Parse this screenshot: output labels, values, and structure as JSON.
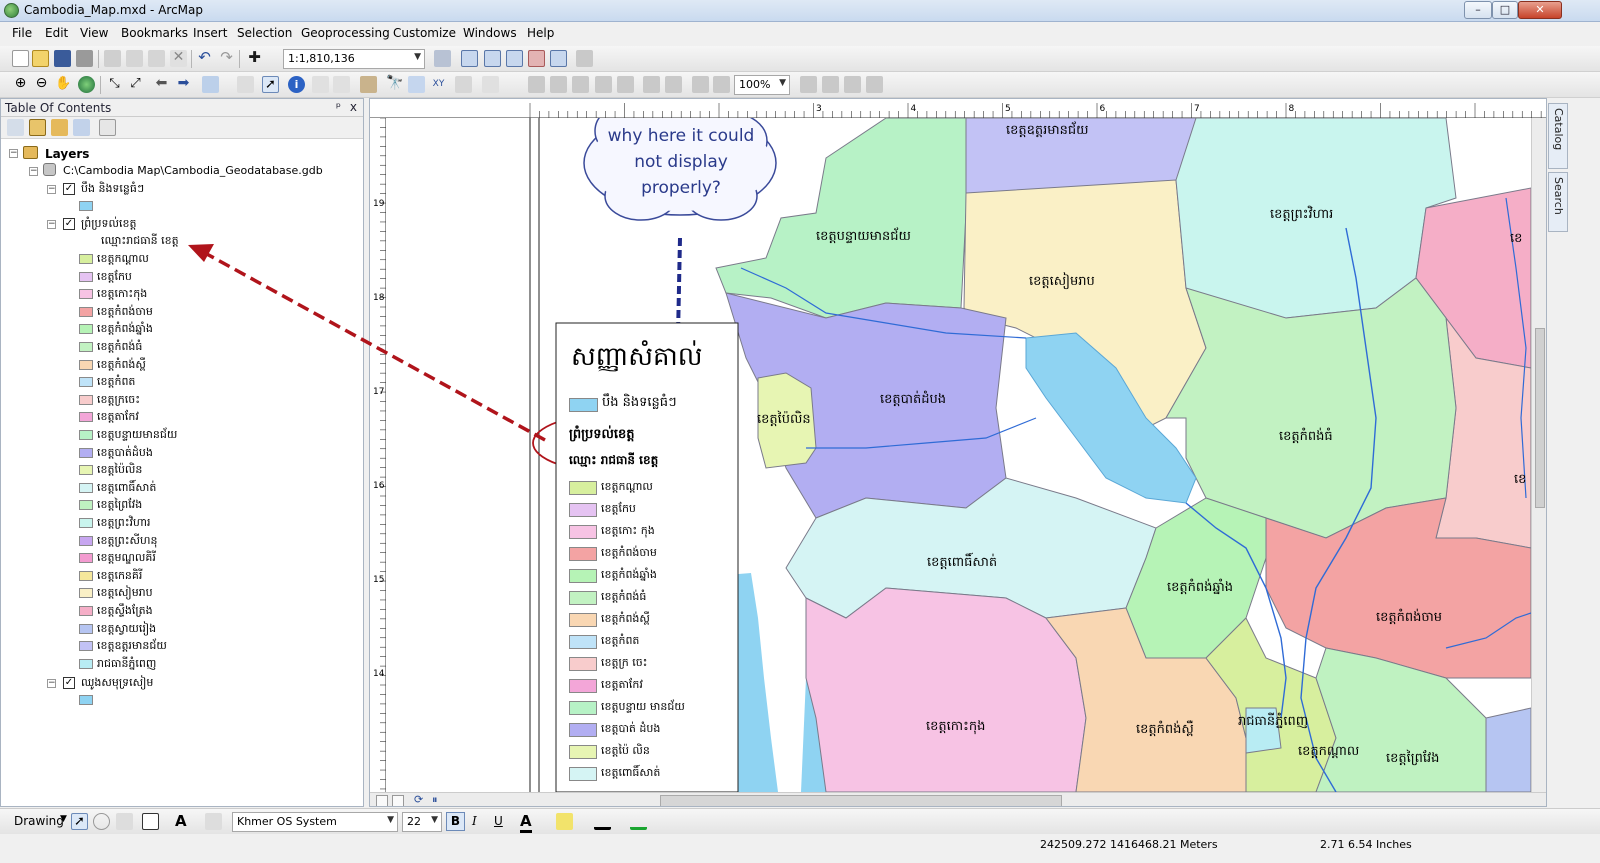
{
  "window": {
    "title": "Cambodia_Map.mxd - ArcMap",
    "min": "–",
    "max": "□",
    "close": "✕"
  },
  "menu": [
    "File",
    "Edit",
    "View",
    "Bookmarks",
    "Insert",
    "Selection",
    "Geoprocessing",
    "Customize",
    "Windows",
    "Help"
  ],
  "toolbar": {
    "scale": "1:1,810,136",
    "zoom": "100%"
  },
  "toc": {
    "header": "Table Of Contents",
    "pin": "ᵖ",
    "close": "x",
    "layers_label": "Layers",
    "gdb_path": "C:\\Cambodia Map\\Cambodia_Geodatabase.gdb",
    "lake_layer": "បឹង និងទន្លេធំៗ",
    "province_layer": "ព្រំប្រទល់ខេត្ត",
    "field_name": "ឈ្មោះរាជធានី ខេត្ត",
    "provinces": [
      {
        "name": "ខេត្តកណ្តាល",
        "color": "#d7ef9e"
      },
      {
        "name": "ខេត្តកែប",
        "color": "#e5c3f2"
      },
      {
        "name": "ខេត្តកោះកុង",
        "color": "#f7c3e4"
      },
      {
        "name": "ខេត្តកំពង់ចាម",
        "color": "#f3a3a3"
      },
      {
        "name": "ខេត្តកំពង់ឆ្នាំង",
        "color": "#b6f3b6"
      },
      {
        "name": "ខេត្តកំពង់ធំ",
        "color": "#c2f2c2"
      },
      {
        "name": "ខេត្តកំពង់ស្ពឺ",
        "color": "#f9d7b3"
      },
      {
        "name": "ខេត្តកំពត",
        "color": "#bfe3f8"
      },
      {
        "name": "ខេត្តក្រចេះ",
        "color": "#f8cccc"
      },
      {
        "name": "ខេត្តតាកែវ",
        "color": "#f3a6d8"
      },
      {
        "name": "ខេត្តបន្ទាយមានជ័យ",
        "color": "#b7f2c6"
      },
      {
        "name": "ខេត្តបាត់ដំបង",
        "color": "#b2aef2"
      },
      {
        "name": "ខេត្តប៉ៃលិន",
        "color": "#e7f5b3"
      },
      {
        "name": "ខេត្តពោធិ៍សាត់",
        "color": "#d5f4f4"
      },
      {
        "name": "ខេត្តព្រៃវែង",
        "color": "#bff2c1"
      },
      {
        "name": "ខេត្តព្រះវិហារ",
        "color": "#c9f5ee"
      },
      {
        "name": "ខេត្តព្រះសីហនុ",
        "color": "#c7a6f0"
      },
      {
        "name": "ខេត្តមណ្ឌលគិរី",
        "color": "#f39bd0"
      },
      {
        "name": "ខេត្តកេនគិរី",
        "color": "#f5e79b"
      },
      {
        "name": "ខេត្តសៀមរាប",
        "color": "#faf0c6"
      },
      {
        "name": "ខេត្តស្ទឹងត្រែង",
        "color": "#f5aec7"
      },
      {
        "name": "ខេត្តស្វាយរៀង",
        "color": "#b6c5f2"
      },
      {
        "name": "ខេត្តឧត្តរមានជ័យ",
        "color": "#c2c2f5"
      },
      {
        "name": "រាជធានីភ្នំពេញ",
        "color": "#b8ecf3"
      }
    ],
    "village_layer": "ឈូងសមុទ្រសៀម",
    "lake_color": "#8fd3f2",
    "sea_color": "#8fd3f2"
  },
  "legend": {
    "title": "សញ្ញាសំគាល់",
    "lake": "បឹង និងទន្លេធំៗ",
    "province_heading": "ព្រំប្រទល់ខេត្ត",
    "field_heading": "ឈ្មោះ រាជធានី ខេត្ត",
    "items": [
      {
        "name": "ខេត្តកណ្តាល",
        "color": "#d7ef9e"
      },
      {
        "name": "ខេត្តកែប",
        "color": "#e5c3f2"
      },
      {
        "name": "ខេត្តកោះ កុង",
        "color": "#f7c3e4"
      },
      {
        "name": "ខេត្តកំពង់ចាម",
        "color": "#f3a3a3"
      },
      {
        "name": "ខេត្តកំពង់ឆ្នាំង",
        "color": "#b6f3b6"
      },
      {
        "name": "ខេត្តកំពង់ធំ",
        "color": "#c2f2c2"
      },
      {
        "name": "ខេត្តកំពង់ស្ពឺ",
        "color": "#f9d7b3"
      },
      {
        "name": "ខេត្តកំពត",
        "color": "#bfe3f8"
      },
      {
        "name": "ខេត្តក្រ ចេះ",
        "color": "#f8cccc"
      },
      {
        "name": "ខេត្តតាកែវ",
        "color": "#f3a6d8"
      },
      {
        "name": "ខេត្តបន្ទាយ មានជ័យ",
        "color": "#b7f2c6"
      },
      {
        "name": "ខេត្តបាត់ ដំបង",
        "color": "#b2aef2"
      },
      {
        "name": "ខេត្តប៉ៃ លិន",
        "color": "#e7f5b3"
      },
      {
        "name": "ខេត្តពោធិ៍សាត់",
        "color": "#d5f4f4"
      }
    ]
  },
  "map_labels": [
    "ខេត្តឧត្តរមានជ័យ",
    "ខេត្តបន្ទាយមានជ័យ",
    "ខេត្តសៀមរាប",
    "ខេត្តព្រះវិហារ",
    "ខេត្តបាត់ដំបង",
    "ខេត្តប៉ៃលិន",
    "ខេត្តកំពង់ធំ",
    "ខេត្តពោធិ៍សាត់",
    "ខេត្តកំពង់ឆ្នាំង",
    "ខេត្តកំពង់ចាម",
    "ខេត្តកោះកុង",
    "ខេត្តកំពង់ស្ពឺ",
    "រាជធានីភ្នំពេញ",
    "ខេត្តកណ្តាល",
    "ខេត្តព្រៃវែង",
    "ខេ",
    "ខេ"
  ],
  "callout": "why here it could not display properly?",
  "ruler": {
    "top": [
      "3",
      "4",
      "5",
      "6",
      "7",
      "8"
    ],
    "left": [
      "19",
      "18",
      "17",
      "16",
      "15",
      "14"
    ]
  },
  "drawing": {
    "label": "Drawing",
    "font": "Khmer OS System",
    "size": "22",
    "bold": "B",
    "italic": "I",
    "underline": "U"
  },
  "status": {
    "coords": "242509.272 1416468.21 Meters",
    "page": "2.71 6.54 Inches"
  },
  "side_tabs": [
    "Catalog",
    "Search"
  ]
}
